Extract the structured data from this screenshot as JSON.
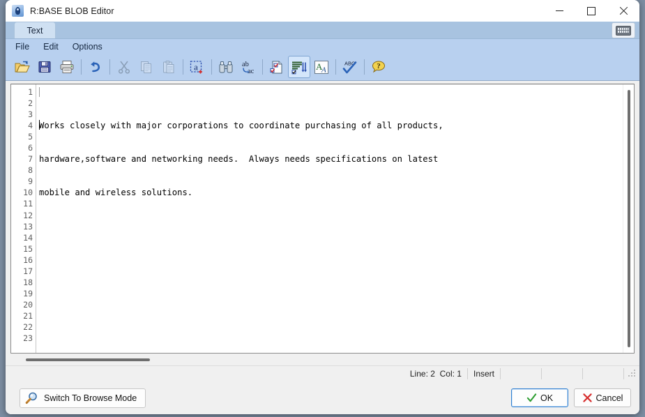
{
  "window": {
    "title": "R:BASE BLOB Editor",
    "app_icon": "rbase-app-icon",
    "controls": {
      "minimize": "minimize-icon",
      "maximize": "maximize-icon",
      "close": "close-icon"
    }
  },
  "tabstrip": {
    "tabs": [
      {
        "label": "Text",
        "active": true
      }
    ],
    "keyboard_button": "keyboard-icon"
  },
  "menubar": {
    "items": [
      {
        "label": "File"
      },
      {
        "label": "Edit"
      },
      {
        "label": "Options"
      }
    ]
  },
  "toolbar": {
    "buttons": [
      {
        "name": "open-button",
        "icon": "open-folder-icon",
        "title": "Open",
        "enabled": true,
        "active": false
      },
      {
        "name": "save-button",
        "icon": "save-floppy-icon",
        "title": "Save",
        "enabled": true,
        "active": false
      },
      {
        "name": "print-button",
        "icon": "printer-icon",
        "title": "Print",
        "enabled": true,
        "active": false
      },
      {
        "name": "undo-button",
        "icon": "undo-arrow-icon",
        "title": "Undo",
        "enabled": true,
        "active": false
      },
      {
        "name": "cut-button",
        "icon": "scissors-icon",
        "title": "Cut",
        "enabled": false,
        "active": false
      },
      {
        "name": "copy-button",
        "icon": "copy-pages-icon",
        "title": "Copy",
        "enabled": false,
        "active": false
      },
      {
        "name": "paste-button",
        "icon": "clipboard-icon",
        "title": "Paste",
        "enabled": false,
        "active": false
      },
      {
        "name": "select-all-button",
        "icon": "select-all-a-icon",
        "title": "Select All",
        "enabled": true,
        "active": false
      },
      {
        "name": "find-button",
        "icon": "binoculars-icon",
        "title": "Find",
        "enabled": true,
        "active": false
      },
      {
        "name": "replace-button",
        "icon": "ab-ac-replace-icon",
        "title": "Replace",
        "enabled": true,
        "active": false
      },
      {
        "name": "form-edit-button",
        "icon": "checkbox-page-icon",
        "title": "Edit",
        "enabled": true,
        "active": false
      },
      {
        "name": "word-wrap-button",
        "icon": "lines-sort-icon",
        "title": "Word Wrap",
        "enabled": true,
        "active": true
      },
      {
        "name": "font-button",
        "icon": "font-aa-icon",
        "title": "Font",
        "enabled": true,
        "active": false
      },
      {
        "name": "spellcheck-button",
        "icon": "abc-check-icon",
        "title": "Spell Check",
        "enabled": true,
        "active": false
      },
      {
        "name": "help-button",
        "icon": "help-question-icon",
        "title": "Help",
        "enabled": true,
        "active": false
      }
    ]
  },
  "editor": {
    "content_lines": [
      "Works closely with major corporations to coordinate purchasing of all products,",
      "hardware,software and networking needs.  Always needs specifications on latest",
      "mobile and wireless solutions."
    ],
    "line_numbers": [
      1,
      2,
      3,
      4,
      5,
      6,
      7,
      8,
      9,
      10,
      11,
      12,
      13,
      14,
      15,
      16,
      17,
      18,
      19,
      20,
      21,
      22,
      23
    ],
    "scrollbars": {
      "vertical": true,
      "horizontal": true
    }
  },
  "statusbar": {
    "line_label": "Line:",
    "line_value": "2",
    "col_label": "Col:",
    "col_value": "1",
    "mode": "Insert",
    "resize_grip": "resize-grip-icon"
  },
  "bottombar": {
    "browse_button": {
      "label": "Switch To Browse Mode",
      "icon": "magnifier-icon"
    },
    "ok_button": {
      "label": "OK",
      "icon": "green-check-icon",
      "default": true
    },
    "cancel_button": {
      "label": "Cancel",
      "icon": "red-x-icon",
      "default": false
    }
  },
  "colors": {
    "titlebar_bg": "#ffffff",
    "tabstrip_bg": "#a8c3e0",
    "tab_active_bg": "#cfe0f2",
    "toolbar_bg": "#b8d0ef",
    "editor_bg": "#ffffff",
    "panel_bg": "#f0f0f0",
    "accent_blue": "#2f7fd0",
    "ok_green": "#2e9e32",
    "cancel_red": "#d62e2e"
  }
}
